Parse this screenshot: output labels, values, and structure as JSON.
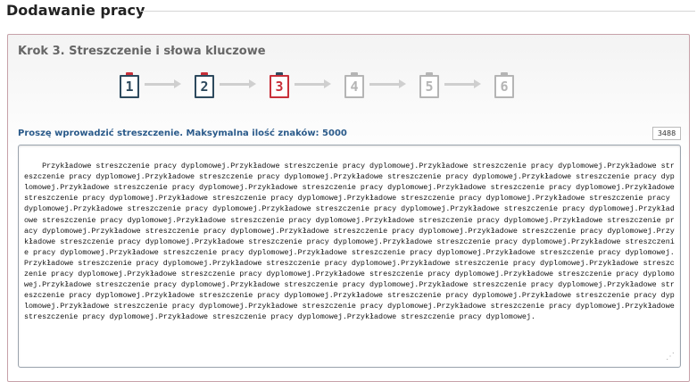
{
  "page": {
    "title": "Dodawanie pracy"
  },
  "step": {
    "heading": "Krok 3. Streszczenie i słowa kluczowe"
  },
  "steps": [
    {
      "label": "1",
      "state": "done"
    },
    {
      "label": "2",
      "state": "done"
    },
    {
      "label": "3",
      "state": "active"
    },
    {
      "label": "4",
      "state": "upcoming"
    },
    {
      "label": "5",
      "state": "upcoming"
    },
    {
      "label": "6",
      "state": "upcoming"
    }
  ],
  "colors": {
    "done": "#2e4a5e",
    "done_clip": "#c8303a",
    "active": "#c8303a",
    "active_clip": "#2e4a5e",
    "upcoming": "#b5b5b5"
  },
  "abstract": {
    "hint": "Proszę wprowadzić streszczenie. Maksymalna ilość znaków: 5000",
    "char_count": "3488",
    "text": "Przykładowe streszczenie pracy dyplomowej.Przykładowe streszczenie pracy dyplomowej.Przykładowe streszczenie pracy dyplomowej.Przykładowe streszczenie pracy dyplomowej.Przykładowe streszczenie pracy dyplomowej.Przykładowe streszczenie pracy dyplomowej.Przykładowe streszczenie pracy dyplomowej.Przykładowe streszczenie pracy dyplomowej.Przykładowe streszczenie pracy dyplomowej.Przykładowe streszczenie pracy dyplomowej.Przykładowe streszczenie pracy dyplomowej.Przykładowe streszczenie pracy dyplomowej.Przykładowe streszczenie pracy dyplomowej.Przykładowe streszczenie pracy dyplomowej.Przykładowe streszczenie pracy dyplomowej.Przykładowe streszczenie pracy dyplomowej.Przykładowe streszczenie pracy dyplomowej.Przykładowe streszczenie pracy dyplomowej.Przykładowe streszczenie pracy dyplomowej.Przykładowe streszczenie pracy dyplomowej.Przykładowe streszczenie pracy dyplomowej.Przykładowe streszczenie pracy dyplomowej.Przykładowe streszczenie pracy dyplomowej.Przykładowe streszczenie pracy dyplomowej.Przykładowe streszczenie pracy dyplomowej.Przykładowe streszczenie pracy dyplomowej.Przykładowe streszczenie pracy dyplomowej.Przykładowe streszczenie pracy dyplomowej.Przykładowe streszczenie pracy dyplomowej.Przykładowe streszczenie pracy dyplomowej.Przykładowe streszczenie pracy dyplomowej.Przykładowe streszczenie pracy dyplomowej.Przykładowe streszczenie pracy dyplomowej.Przykładowe streszczenie pracy dyplomowej.Przykładowe streszczenie pracy dyplomowej.Przykładowe streszczenie pracy dyplomowej.Przykładowe streszczenie pracy dyplomowej.Przykładowe streszczenie pracy dyplomowej.Przykładowe streszczenie pracy dyplomowej.Przykładowe streszczenie pracy dyplomowej.Przykładowe streszczenie pracy dyplomowej.Przykładowe streszczenie pracy dyplomowej.Przykładowe streszczenie pracy dyplomowej.Przykładowe streszczenie pracy dyplomowej.Przykładowe streszczenie pracy dyplomowej.Przykładowe streszczenie pracy dyplomowej.Przykładowe streszczenie pracy dyplomowej.Przykładowe streszczenie pracy dyplomowej.Przykładowe streszczenie pracy dyplomowej.Przykładowe streszczenie pracy dyplomowej.Przykładowe streszczenie pracy dyplomowej."
  }
}
